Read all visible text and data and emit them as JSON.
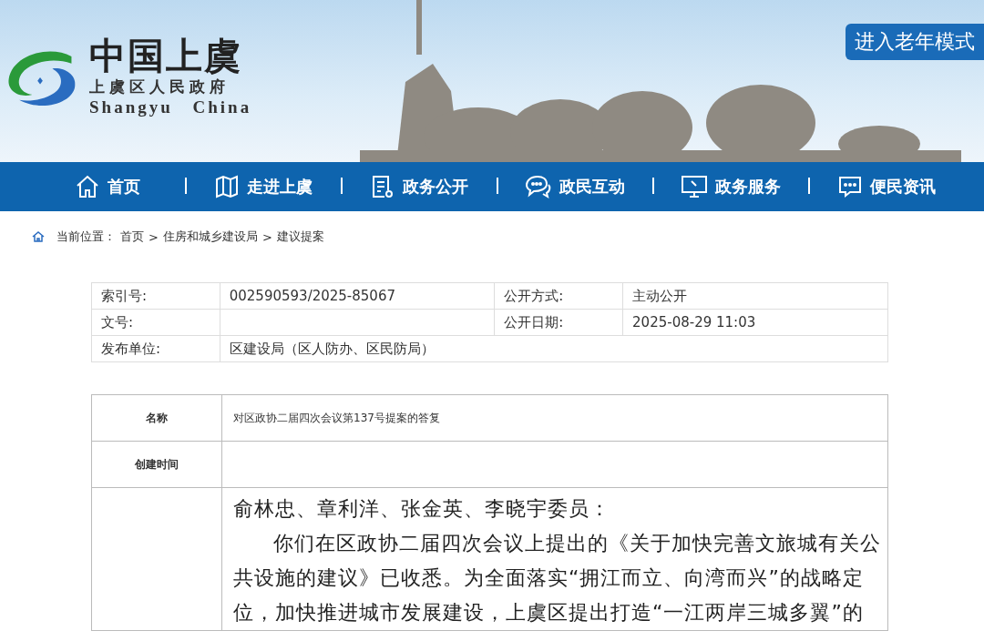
{
  "header": {
    "title": "中国上虞",
    "subtitle": "上虞区人民政府",
    "english": "Shangyu China",
    "elder_mode_button": "进入老年模式"
  },
  "nav": [
    {
      "label": "首页"
    },
    {
      "label": "走进上虞"
    },
    {
      "label": "政务公开"
    },
    {
      "label": "政民互动"
    },
    {
      "label": "政务服务"
    },
    {
      "label": "便民资讯"
    }
  ],
  "breadcrumb": {
    "label": "当前位置：",
    "separator": ">",
    "items": [
      "首页",
      "住房和城乡建设局",
      "建议提案"
    ]
  },
  "meta_table": [
    [
      {
        "label": "索引号:",
        "value": "002590593/2025-85067"
      },
      {
        "label": "公开方式:",
        "value": "主动公开"
      }
    ],
    [
      {
        "label": "文号:"
      },
      {
        "label": "公开日期:",
        "value": "2025-08-29 11:03"
      }
    ],
    [
      {
        "label": "发布单位:",
        "value": "区建设局（区人防办、区民防局）"
      }
    ]
  ],
  "detail_table": [
    {
      "label": "名称",
      "value": "对区政协二届四次会议第137号提案的答复"
    },
    {
      "label": "创建时间"
    }
  ],
  "letter": {
    "salutation": "俞林忠、章利洋、张金英、李晓宇委员：",
    "paragraph": "你们在区政协二届四次会议上提出的《关于加快完善文旅城有关公共设施的建议》已收悉。为全面落实“拥江而立、向湾而兴”的战略定位，加快推进城市发展建设，上虞区提出打造“一江两岸三城多翼”的"
  }
}
